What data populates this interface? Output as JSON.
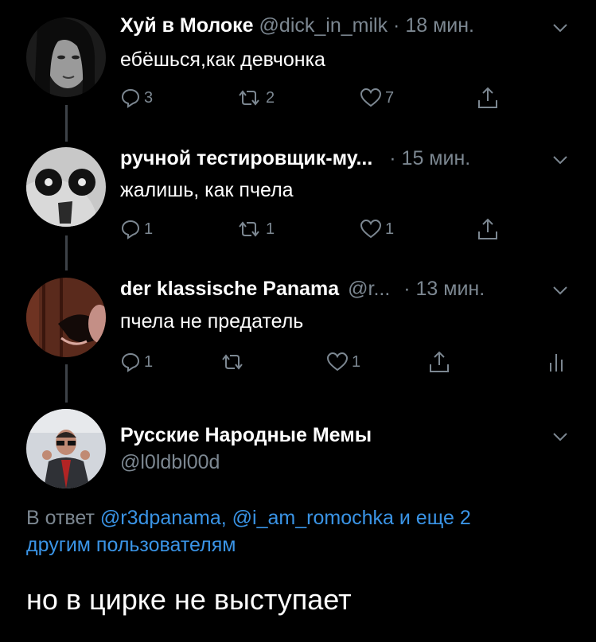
{
  "tweets": [
    {
      "name": "Хуй в Молоке",
      "handle": "@dick_in_milk",
      "time": "· 18 мин.",
      "text": "ебёшься,как девчонка",
      "replies": "3",
      "retweets": "2",
      "likes": "7"
    },
    {
      "name": "ручной тестировщик-му...",
      "handle": "",
      "time": "· 15 мин.",
      "text": "жалишь, как пчела",
      "replies": "1",
      "retweets": "1",
      "likes": "1"
    },
    {
      "name": "der klassische Panama",
      "handle": "@r...",
      "time": "· 13 мин.",
      "text": "пчела не предатель",
      "replies": "1",
      "retweets": "",
      "likes": "1"
    }
  ],
  "main": {
    "name": "Русские Народные Мемы",
    "handle": "@l0ldbl00d",
    "reply_prefix": "В ответ",
    "reply_user1": "@r3dpanama,",
    "reply_user2": "@i_am_romochka",
    "reply_and": "и еще 2",
    "reply_suffix": "другим пользователям",
    "text": "но в цирке не выступает"
  },
  "colors": {
    "background": "#000000",
    "secondary_text": "#7c8791",
    "link": "#3a94e6",
    "thread_line": "#3d4248"
  },
  "icons": [
    "reply-icon",
    "retweet-icon",
    "like-icon",
    "share-icon",
    "analytics-icon",
    "chevron-down-icon"
  ]
}
